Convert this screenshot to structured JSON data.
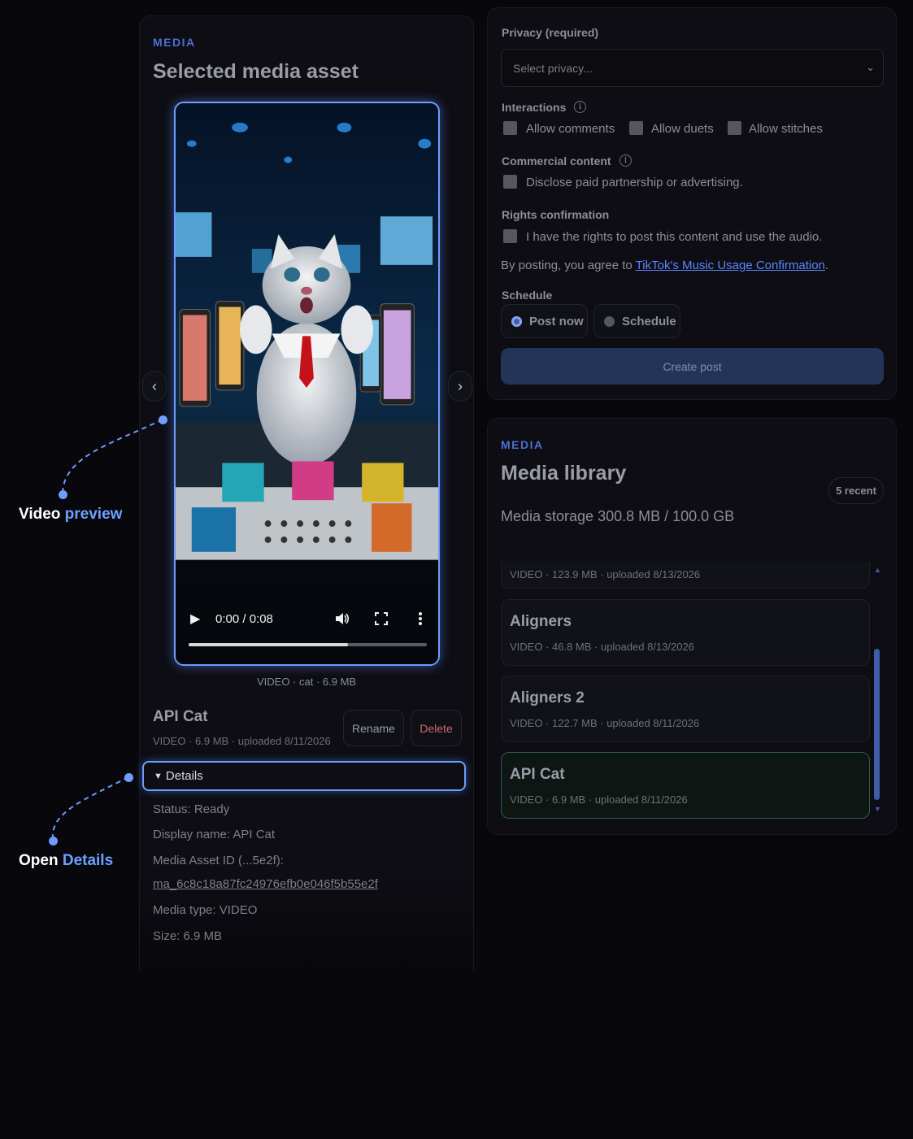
{
  "left": {
    "eyebrow": "MEDIA",
    "title": "Selected media asset",
    "video": {
      "time": "0:00 / 0:08",
      "progress": 0.67,
      "icons": [
        "play-icon",
        "volume-icon",
        "fullscreen-icon",
        "more-options-icon"
      ]
    },
    "nav": {
      "prev": "‹",
      "next": "›"
    },
    "caption": "VIDEO · cat · 6.9 MB",
    "asset": {
      "name": "API Cat",
      "meta": "VIDEO · 6.9 MB · uploaded 8/11/2026",
      "rename_label": "Rename",
      "delete_label": "Delete"
    },
    "details": {
      "toggle_label": "Details",
      "status": "Status: Ready",
      "display_name": "Display name: API Cat",
      "asset_id_label": "Media Asset ID (...5e2f):",
      "asset_id": "ma_6c8c18a87fc24976efb0e046f5b55e2f",
      "media_type": "Media type: VIDEO",
      "size": "Size: 6.9 MB"
    }
  },
  "annotations": {
    "video_preview": {
      "prefix": "Video",
      "accent": "preview"
    },
    "open_details": {
      "prefix": "Open",
      "accent": "Details"
    }
  },
  "form": {
    "privacy_label": "Privacy (required)",
    "privacy_placeholder": "Select privacy...",
    "interactions_label": "Interactions",
    "allow_comments": "Allow comments",
    "allow_duets": "Allow duets",
    "allow_stitches": "Allow stitches",
    "commercial_label": "Commercial content",
    "commercial_checkbox": "Disclose paid partnership or advertising.",
    "rights_label": "Rights confirmation",
    "rights_checkbox": "I have the rights to post this content and use the audio.",
    "agree_prefix": "By posting, you agree to ",
    "agree_link": "TikTok's Music Usage Confirmation",
    "agree_suffix": ".",
    "schedule_label": "Schedule",
    "post_now": "Post now",
    "schedule_option": "Schedule",
    "create_post": "Create post"
  },
  "library": {
    "eyebrow": "MEDIA",
    "title": "Media library",
    "recent_badge": "5 recent",
    "storage": "Media storage 300.8 MB / 100.0 GB",
    "items": [
      {
        "title": "",
        "meta": "VIDEO · 123.9 MB · uploaded 8/13/2026"
      },
      {
        "title": "Aligners",
        "meta": "VIDEO · 46.8 MB · uploaded 8/13/2026"
      },
      {
        "title": "Aligners 2",
        "meta": "VIDEO · 122.7 MB · uploaded 8/11/2026"
      },
      {
        "title": "API Cat",
        "meta": "VIDEO · 6.9 MB · uploaded 8/11/2026",
        "selected": true
      }
    ]
  },
  "colors": {
    "accent": "#6e9cff",
    "eyebrow": "#4d6fd0",
    "link": "#5d86ff",
    "delete": "#c96a6a",
    "primary_button": "#243358",
    "selected_border": "#2f5a4a"
  }
}
